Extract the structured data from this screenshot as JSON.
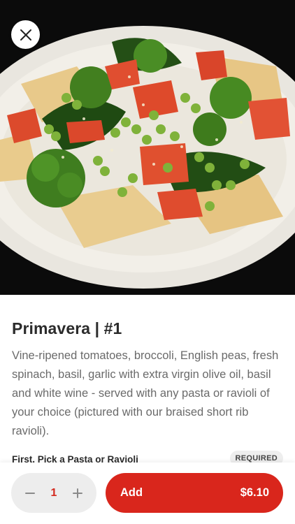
{
  "item": {
    "title": "Primavera | #1",
    "description": "Vine-ripened tomatoes, broccoli, English peas, fresh spinach, basil, garlic with extra virgin olive oil, basil and white wine - served with any pasta or ravioli of your choice (pictured with our braised short rib ravioli).",
    "image_subject": "plate of ravioli with broccoli, peas, tomatoes and spinach"
  },
  "options": {
    "section_title": "First, Pick a Pasta or Ravioli",
    "required_badge": "REQUIRED"
  },
  "cart": {
    "quantity": "1",
    "add_label": "Add",
    "price": "$6.10"
  },
  "colors": {
    "accent": "#d9261c",
    "quantity_text": "#d32a1f",
    "stepper_bg": "#ededed"
  },
  "icons": {
    "close": "close-icon",
    "minus": "minus-icon",
    "plus": "plus-icon"
  }
}
